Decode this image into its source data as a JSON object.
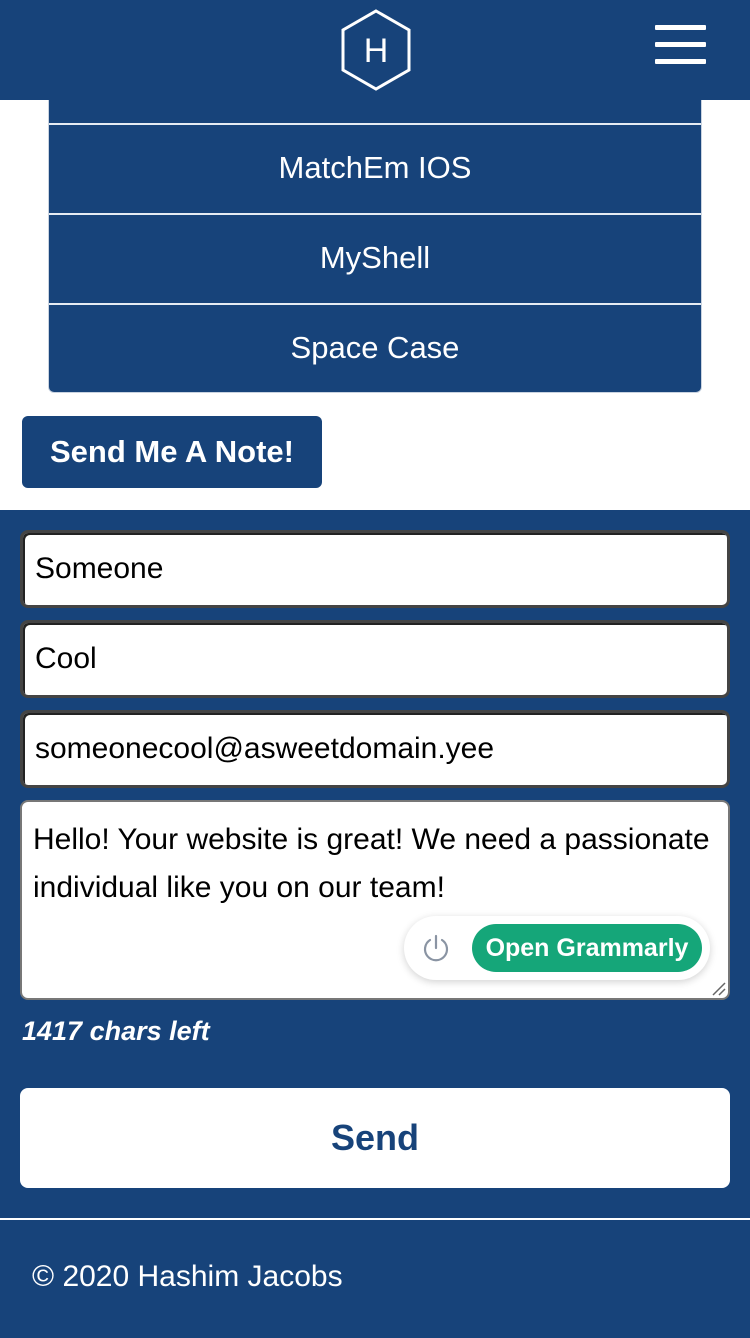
{
  "header": {
    "logo_letter": "H",
    "menu_icon": "hamburger-menu-icon"
  },
  "projects": {
    "items": [
      {
        "label": "MatchEm IOS"
      },
      {
        "label": "MyShell"
      },
      {
        "label": "Space Case"
      }
    ]
  },
  "note_button": {
    "label": "Send Me A Note!"
  },
  "contact_form": {
    "first_name": "Someone",
    "last_name": "Cool",
    "email": "someonecool@asweetdomain.yee",
    "message": "Hello! Your website is great! We need a passionate individual like you on our team!",
    "chars_left": "1417 chars left",
    "send_label": "Send"
  },
  "grammarly": {
    "button_label": "Open Grammarly",
    "icon": "power-icon"
  },
  "footer": {
    "copyright": "© 2020 Hashim Jacobs"
  },
  "colors": {
    "primary": "#17437a",
    "white": "#ffffff",
    "grammarly_green": "#15a679"
  }
}
